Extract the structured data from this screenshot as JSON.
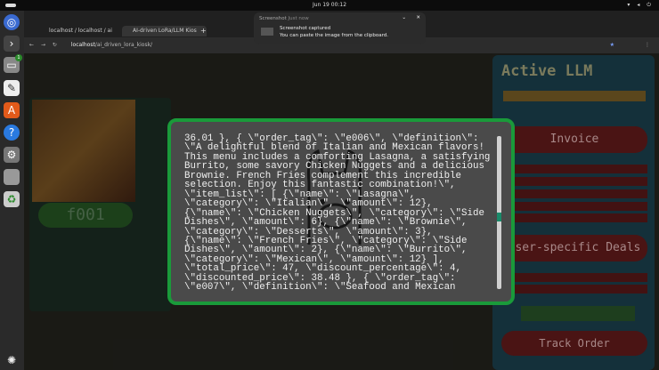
{
  "system": {
    "clock": "Jun 19  00:12",
    "tray": "▾ ◂ ⏻"
  },
  "dock": {
    "icons": [
      "chromium-icon",
      "terminal-icon",
      "files-icon",
      "text-editor-icon",
      "app-center-icon",
      "help-icon",
      "settings-icon",
      "disk-icon",
      "trash-icon",
      "apps-grid-icon"
    ],
    "files_badge": "1"
  },
  "browser": {
    "tabs": [
      {
        "label": "localhost / localhost / ai"
      },
      {
        "label": "AI-driven LoRa/LLM Kios"
      }
    ],
    "new_tab": "+",
    "url_host": "localhost",
    "url_path": "/ai_driven_lora_kiosk/"
  },
  "notification": {
    "app": "Screenshot",
    "time": "Just now",
    "title": "Screenshot captured",
    "body": "You can paste the image from the clipboard."
  },
  "page": {
    "menu_tag": "f001"
  },
  "right_panel": {
    "title": "Active LLM",
    "invoice": "Invoice",
    "deals": "User-specific Deals",
    "track": "Track Order"
  },
  "modal": {
    "lines": [
      "36.01 }, { \\\"order_tag\\\": \\\"e006\\\", \\\"definition\\\":",
      "\\\"A delightful blend of Italian and Mexican flavors!",
      "This menu includes a comforting Lasagna, a satisfying",
      "Burrito, some savory Chicken Nuggets and a delicious",
      "Brownie. French Fries complement this incredible",
      "selection. Enjoy this fantastic combination!\\\",",
      "\\\"item_list\\\": [ {\\\"name\\\": \\\"Lasagna\\\",",
      "\\\"category\\\": \\\"Italian\\\", \\\"amount\\\": 12},",
      "{\\\"name\\\": \\\"Chicken Nuggets\\\", \\\"category\\\": \\\"Side",
      "Dishes\\\", \\\"amount\\\": 6}, {\\\"name\\\": \\\"Brownie\\\",",
      "\\\"category\\\": \\\"Desserts\\\", \\\"amount\\\": 3},",
      "{\\\"name\\\": \\\"French Fries\\\", \\\"category\\\": \\\"Side",
      "Dishes\\\", \\\"amount\\\": 2}, {\\\"name\\\": \\\"Burrito\\\",",
      "\\\"category\\\": \\\"Mexican\\\", \\\"amount\\\": 12} ],",
      "\\\"total_price\\\": 47, \\\"discount_percentage\\\": 4,",
      "\\\"discounted_price\\\": 38.48 }, { \\\"order_tag\\\":",
      "\\\"e007\\\", \\\"definition\\\": \\\"Seafood and Mexican"
    ],
    "scroll_position": 0.53
  },
  "colors": {
    "modal_border": "#1a9a3a",
    "modal_bg": "#4a4a4a"
  }
}
